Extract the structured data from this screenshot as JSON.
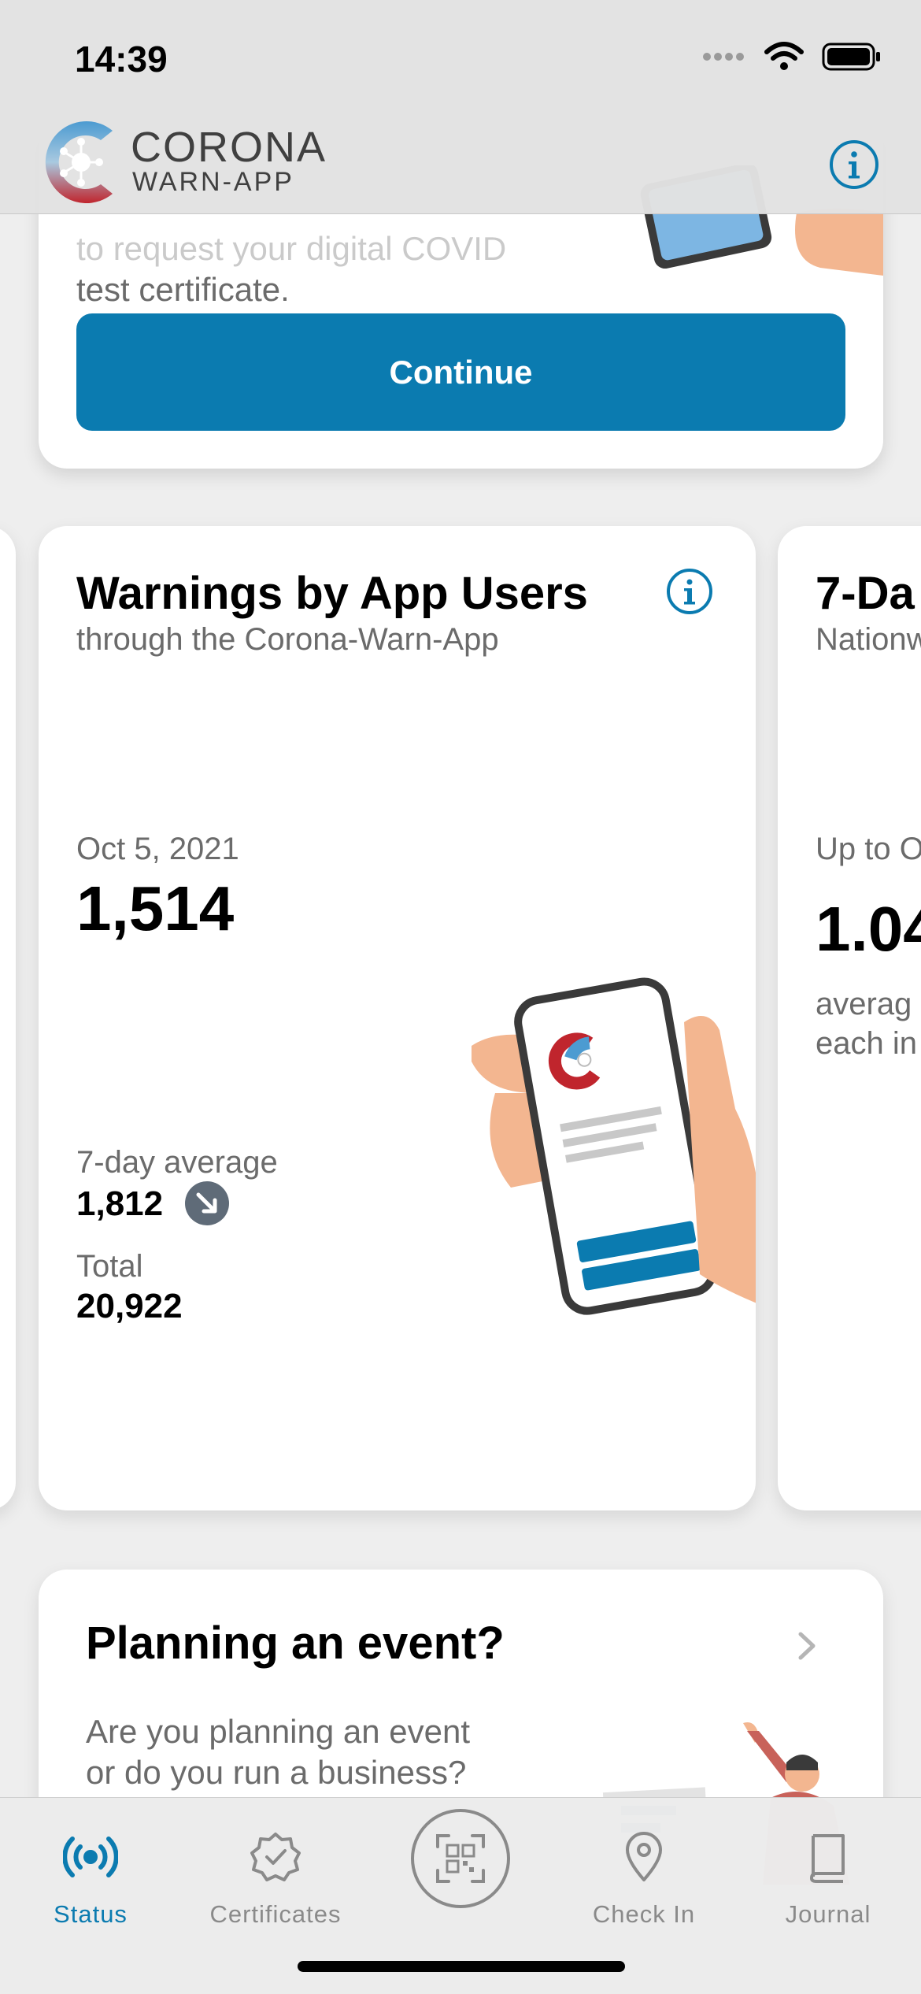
{
  "status_bar": {
    "time": "14:39"
  },
  "header": {
    "logo_line1": "CORONA",
    "logo_line2": "WARN-APP"
  },
  "top_card": {
    "text_partial": "to request your digital COVID",
    "text_line2": "test certificate.",
    "continue_label": "Continue"
  },
  "stats": {
    "main": {
      "title": "Warnings by App Users",
      "subtitle": "through the Corona-Warn-App",
      "date": "Oct 5, 2021",
      "value": "1,514",
      "avg_label": "7-day average",
      "avg_value": "1,812",
      "total_label": "Total",
      "total_value": "20,922"
    },
    "next": {
      "title": "7-Da",
      "subtitle": "Nationw",
      "date": "Up to O",
      "value": "1.04",
      "desc_line1": "averag",
      "desc_line2": "each in"
    }
  },
  "event_card": {
    "title": "Planning an event?",
    "text_line1": "Are you planning an event",
    "text_line2": "or do you run a business?"
  },
  "tabs": [
    {
      "label": "Status",
      "icon": "status-radio-icon",
      "active": true
    },
    {
      "label": "Certificates",
      "icon": "certificate-badge-icon",
      "active": false
    },
    {
      "label": "",
      "icon": "qr-scan-icon",
      "active": false
    },
    {
      "label": "Check In",
      "icon": "location-pin-icon",
      "active": false
    },
    {
      "label": "Journal",
      "icon": "journal-book-icon",
      "active": false
    }
  ],
  "colors": {
    "accent": "#0b7bb0",
    "trend_badge": "#5f6b78",
    "logo_red": "#c0252d",
    "logo_blue": "#4c9bd1"
  }
}
